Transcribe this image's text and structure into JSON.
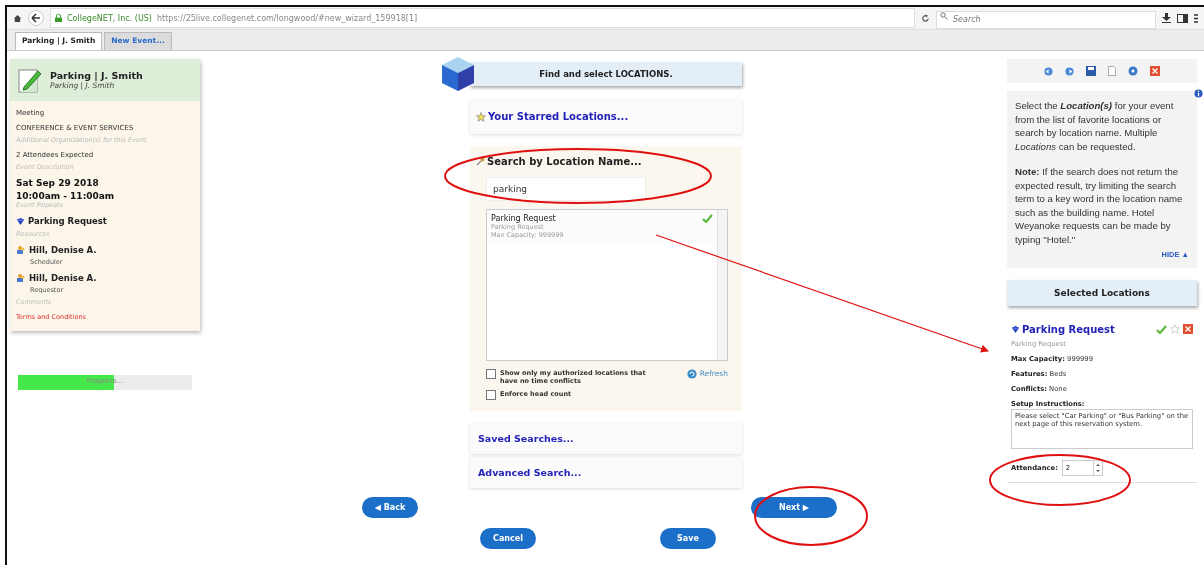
{
  "browser": {
    "site": "CollegeNET, Inc. (US)",
    "url": "https://25live.collegenet.com/longwood/#new_wizard_159918[1]",
    "search_placeholder": "Search"
  },
  "tabs": [
    {
      "label": "Parking | J. Smith",
      "selected": true
    },
    {
      "label": "New Event...",
      "selected": false
    }
  ],
  "event_card": {
    "title": "Parking | J. Smith",
    "subtitle": "Parking | J. Smith",
    "items": [
      {
        "kind": "plain",
        "text": "Meeting"
      },
      {
        "kind": "plain",
        "text": "CONFERENCE & EVENT SERVICES"
      },
      {
        "kind": "hint",
        "text": "Additional Organization(s) for this Event"
      },
      {
        "kind": "plain",
        "text": "2 Attendees Expected"
      },
      {
        "kind": "hint",
        "text": "Event Description"
      },
      {
        "kind": "date",
        "text": "Sat Sep 29 2018"
      },
      {
        "kind": "date",
        "text": "10:00am - 11:00am"
      },
      {
        "kind": "hint",
        "text": "Event Repeats"
      },
      {
        "kind": "location",
        "text": "Parking Request"
      },
      {
        "kind": "hint",
        "text": "Resources"
      },
      {
        "kind": "person",
        "text": "Hill, Denise A.",
        "role": "Scheduler"
      },
      {
        "kind": "person",
        "text": "Hill, Denise A.",
        "role": "Requestor"
      },
      {
        "kind": "hint",
        "text": "Comments"
      },
      {
        "kind": "link",
        "text": "Terms and Conditions"
      }
    ]
  },
  "progress": {
    "label": "Progress...",
    "level": 0.55
  },
  "wizard": {
    "header": "Find and select LOCATIONS.",
    "starred": "Your Starred Locations...",
    "search": {
      "title": "Search by Location Name...",
      "value": "parking",
      "results": [
        {
          "name": "Parking Request",
          "subtitle": "Parking Request",
          "capacity": "Max Capacity: 999999",
          "selected": true
        }
      ],
      "options": [
        {
          "label": "Show only my authorized locations that have no time conflicts",
          "checked": false
        },
        {
          "label": "Enforce head count",
          "checked": false
        }
      ],
      "refresh": "Refresh"
    },
    "saved": "Saved Searches...",
    "advanced": "Advanced Search..."
  },
  "help": {
    "text": "Select the **Location(s)** for your event from the list of favorite locations or search by location name. Multiple *Locations* can be requested.",
    "note": "**Note:** If the search does not return the expected result, try limiting the search term to a key word in the location name such as the building name. Hotel Weyanoke requests can be made by typing \"Hotel.\"",
    "hide": "HIDE ▲"
  },
  "selected_locations": {
    "header": "Selected Locations",
    "items": [
      {
        "name": "Parking Request",
        "subtitle": "Parking Request",
        "approved": true,
        "starred": false,
        "fields": [
          {
            "label": "Max Capacity:",
            "value": "999999"
          },
          {
            "label": "Features:",
            "value": "Beds"
          },
          {
            "label": "Conflicts:",
            "value": "None"
          }
        ],
        "setup_label": "Setup Instructions:",
        "setup_text": "Please select \"Car Parking\" or \"Bus Parking\" on the next page of this reservation system.",
        "attendance_label": "Attendance:",
        "attendance": "2"
      }
    ]
  },
  "buttons": {
    "back": "◀ Back",
    "next": "Next ▶",
    "cancel": "Cancel",
    "save": "Save"
  }
}
